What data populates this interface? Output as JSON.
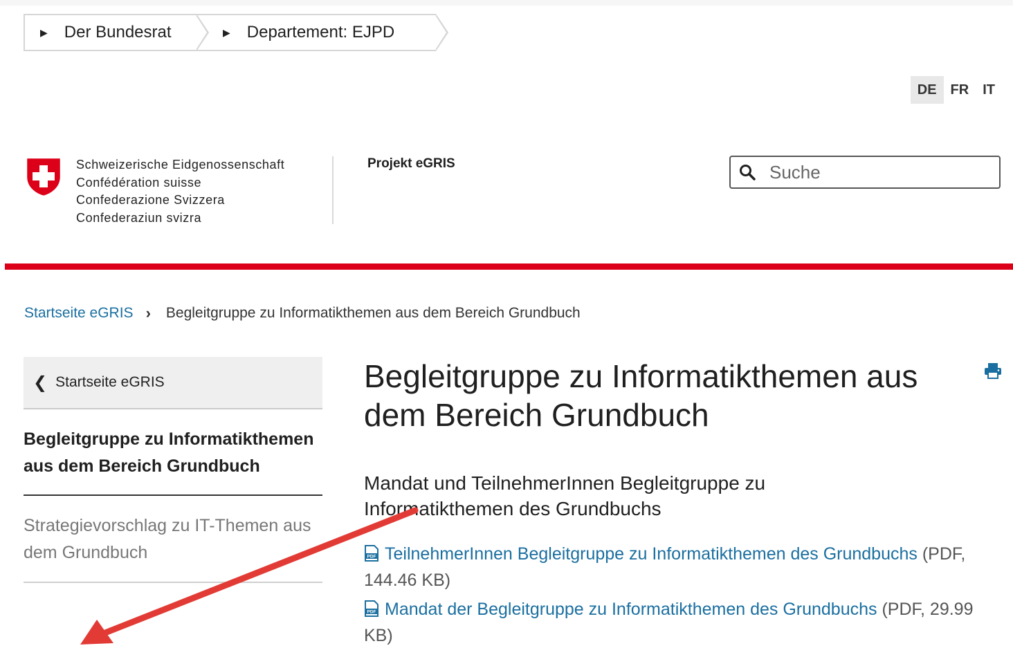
{
  "dept_nav": {
    "items": [
      {
        "label": "Der Bundesrat"
      },
      {
        "label": "Departement: EJPD"
      }
    ]
  },
  "lang": {
    "items": [
      "DE",
      "FR",
      "IT"
    ],
    "active": "DE"
  },
  "logo": {
    "lines": [
      "Schweizerische Eidgenossenschaft",
      "Confédération suisse",
      "Confederazione Svizzera",
      "Confederaziun svizra"
    ]
  },
  "project": {
    "title": "Projekt eGRIS"
  },
  "search": {
    "placeholder": "Suche",
    "icon": "search-icon"
  },
  "colors": {
    "accent_red": "#dc0018",
    "link_blue": "#1b6fa0"
  },
  "breadcrumb": {
    "home": "Startseite eGRIS",
    "current": "Begleitgruppe zu Informatikthemen aus dem Bereich Grundbuch"
  },
  "sidebar": {
    "back_label": "Startseite eGRIS",
    "active_label": "Begleitgruppe zu Informatikthemen aus dem Bereich Grundbuch",
    "items": [
      {
        "label": "Strategievorschlag zu IT-Themen aus dem Grundbuch"
      }
    ]
  },
  "main": {
    "title": "Begleitgruppe zu Informatikthemen aus dem Bereich Grundbuch",
    "section_title": "Mandat und TeilnehmerInnen Begleitgruppe zu Informatikthemen des Grundbuchs",
    "documents": [
      {
        "link": "TeilnehmerInnen Begleitgruppe zu Informatikthemen des Grundbuchs",
        "meta": "(PDF, 144.46 KB)"
      },
      {
        "link": "Mandat der Begleitgruppe zu Informatikthemen des Grundbuchs",
        "meta": "(PDF, 29.99 KB)"
      }
    ]
  }
}
